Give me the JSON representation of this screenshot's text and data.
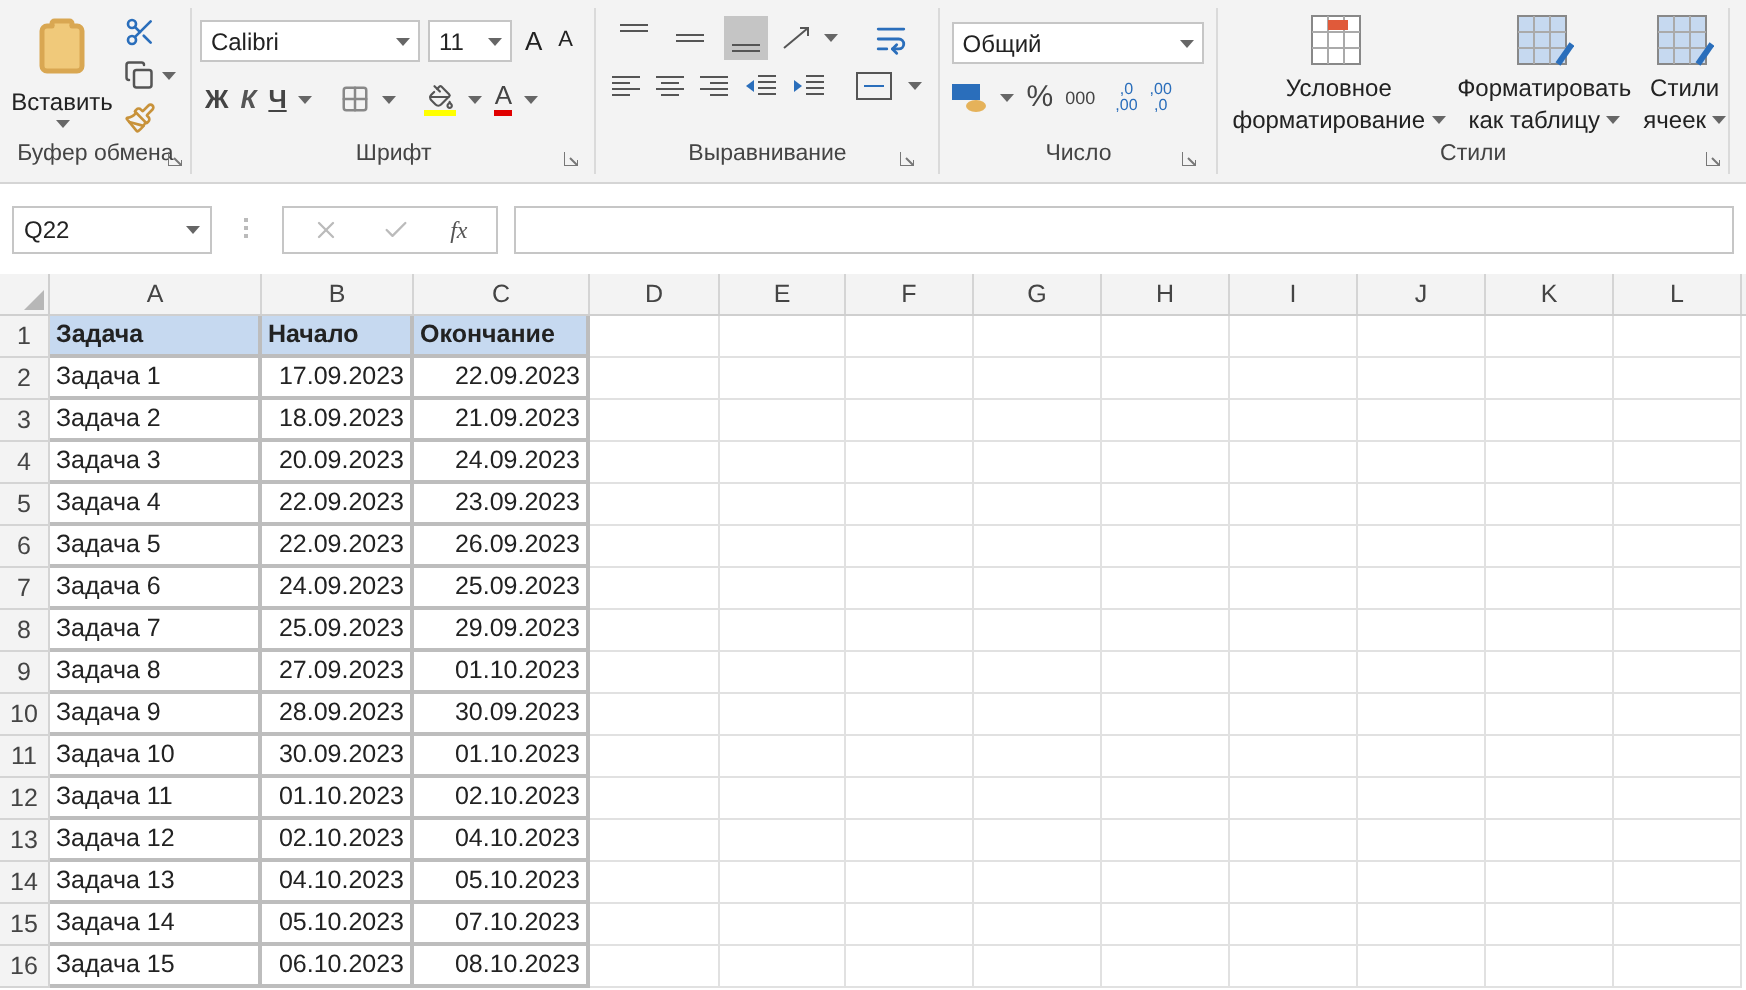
{
  "ribbon": {
    "groups": [
      {
        "label": "Буфер обмена",
        "paste": "Вставить"
      },
      {
        "label": "Шрифт",
        "font_name": "Calibri",
        "font_size": "11",
        "grow": "A",
        "shrink": "A",
        "bold": "Ж",
        "italic": "К",
        "underline": "Ч",
        "font_color": "A"
      },
      {
        "label": "Выравнивание",
        "vertical_align": [
          {
            "selected": false
          },
          {
            "selected": false
          },
          {
            "selected": true
          }
        ]
      },
      {
        "label": "Число",
        "format": "Общий",
        "percent": "%",
        "thousands": "000",
        "increase_decimal": [
          ",0",
          ",00"
        ],
        "decrease_decimal": [
          ",00",
          ",0"
        ]
      },
      {
        "label": "Стили",
        "buttons": [
          {
            "lines": [
              "Условное",
              "форматирование"
            ]
          },
          {
            "lines": [
              "Форматировать",
              "как таблицу"
            ]
          },
          {
            "lines": [
              "Стили",
              "ячеек"
            ]
          }
        ]
      }
    ]
  },
  "formula_bar": {
    "name_box": "Q22",
    "fx": "fx"
  },
  "sheet": {
    "columns": [
      "A",
      "B",
      "C",
      "D",
      "E",
      "F",
      "G",
      "H",
      "I",
      "J",
      "K",
      "L"
    ],
    "rows": [
      {
        "number": "1",
        "cells": [
          "Задача",
          "Начало",
          "Окончание"
        ],
        "header": true
      },
      {
        "number": "2",
        "cells": [
          "Задача 1",
          "17.09.2023",
          "22.09.2023"
        ],
        "header": false
      },
      {
        "number": "3",
        "cells": [
          "Задача 2",
          "18.09.2023",
          "21.09.2023"
        ],
        "header": false
      },
      {
        "number": "4",
        "cells": [
          "Задача 3",
          "20.09.2023",
          "24.09.2023"
        ],
        "header": false
      },
      {
        "number": "5",
        "cells": [
          "Задача 4",
          "22.09.2023",
          "23.09.2023"
        ],
        "header": false
      },
      {
        "number": "6",
        "cells": [
          "Задача 5",
          "22.09.2023",
          "26.09.2023"
        ],
        "header": false
      },
      {
        "number": "7",
        "cells": [
          "Задача 6",
          "24.09.2023",
          "25.09.2023"
        ],
        "header": false
      },
      {
        "number": "8",
        "cells": [
          "Задача 7",
          "25.09.2023",
          "29.09.2023"
        ],
        "header": false
      },
      {
        "number": "9",
        "cells": [
          "Задача 8",
          "27.09.2023",
          "01.10.2023"
        ],
        "header": false
      },
      {
        "number": "10",
        "cells": [
          "Задача 9",
          "28.09.2023",
          "30.09.2023"
        ],
        "header": false
      },
      {
        "number": "11",
        "cells": [
          "Задача 10",
          "30.09.2023",
          "01.10.2023"
        ],
        "header": false
      },
      {
        "number": "12",
        "cells": [
          "Задача 11",
          "01.10.2023",
          "02.10.2023"
        ],
        "header": false
      },
      {
        "number": "13",
        "cells": [
          "Задача 12",
          "02.10.2023",
          "04.10.2023"
        ],
        "header": false
      },
      {
        "number": "14",
        "cells": [
          "Задача 13",
          "04.10.2023",
          "05.10.2023"
        ],
        "header": false
      },
      {
        "number": "15",
        "cells": [
          "Задача 14",
          "05.10.2023",
          "07.10.2023"
        ],
        "header": false
      },
      {
        "number": "16",
        "cells": [
          "Задача 15",
          "06.10.2023",
          "08.10.2023"
        ],
        "header": false
      }
    ]
  }
}
